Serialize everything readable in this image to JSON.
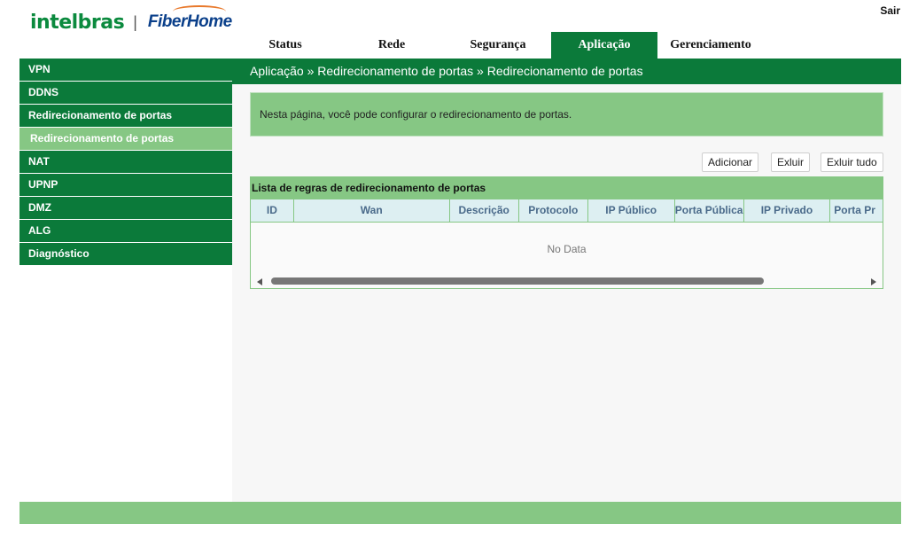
{
  "brand": {
    "logo1": "intelbras",
    "separator": "|",
    "logo2": "FiberHome"
  },
  "header": {
    "logout_label": "Sair"
  },
  "topnav": [
    "Status",
    "Rede",
    "Segurança",
    "Aplicação",
    "Gerenciamento"
  ],
  "topnav_active": "Aplicação",
  "sidebar": [
    "VPN",
    "DDNS",
    "Redirecionamento de portas",
    "Redirecionamento de portas",
    "NAT",
    "UPNP",
    "DMZ",
    "ALG",
    "Diagnóstico"
  ],
  "breadcrumb": "Aplicação » Redirecionamento de portas » Redirecionamento de portas",
  "info_text": "Nesta página, você pode configurar o redirecionamento de portas.",
  "buttons": {
    "add": "Adicionar",
    "delete": "Exluir",
    "delete_all": "Exluir tudo"
  },
  "table": {
    "title": "Lista de regras de redirecionamento de portas",
    "columns": [
      "ID",
      "Wan",
      "Descrição",
      "Protocolo",
      "IP Público",
      "Porta Pública",
      "IP Privado",
      "Porta Pr"
    ],
    "empty_text": "No Data"
  },
  "colors": {
    "primary": "#0b7a3a",
    "light": "#86c784",
    "header_bg": "#ddeff2"
  }
}
